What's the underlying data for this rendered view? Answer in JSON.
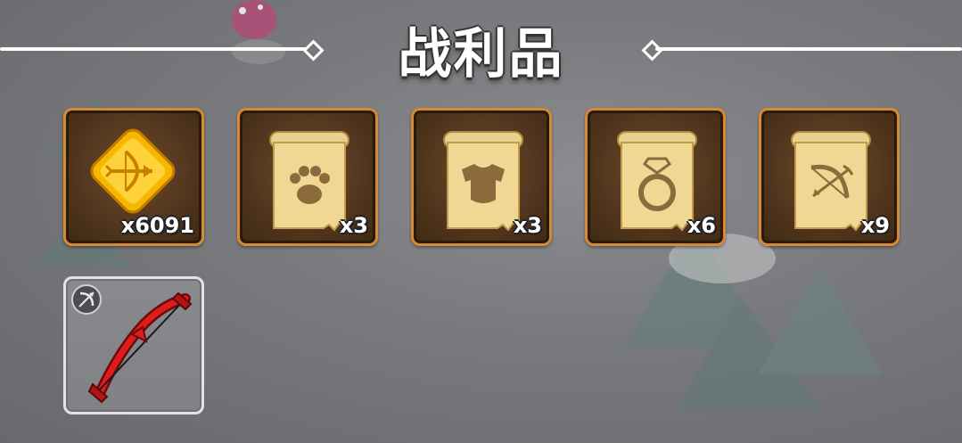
{
  "title": "战利品",
  "rewards": [
    {
      "name": "gold-arrow-token",
      "quantity": "x6091",
      "icon": "bow-coin-icon"
    },
    {
      "name": "pet-scroll",
      "quantity": "x3",
      "icon": "paw-scroll-icon"
    },
    {
      "name": "armor-scroll",
      "quantity": "x3",
      "icon": "armor-scroll-icon"
    },
    {
      "name": "ring-scroll",
      "quantity": "x6",
      "icon": "ring-scroll-icon"
    },
    {
      "name": "bow-scroll",
      "quantity": "x9",
      "icon": "bow-scroll-icon"
    }
  ],
  "equipment": [
    {
      "name": "red-bow",
      "icon": "red-bow-icon",
      "badge": "bow-type-icon"
    }
  ],
  "colors": {
    "slot_border": "#d58a33",
    "slot_fill": "#4c321b",
    "gray_slot_border": "#e2e3e4",
    "title_color": "#ffffff"
  }
}
